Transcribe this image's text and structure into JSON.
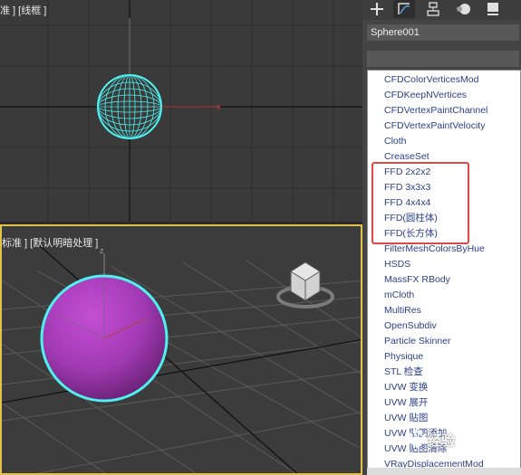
{
  "viewport_top": {
    "label": "准 ] [线框 ]"
  },
  "viewport_persp": {
    "label": "标准 ] [默认明暗处理 ]"
  },
  "command_panel": {
    "tabs": [
      "create-icon",
      "modify-icon",
      "hierarchy-icon",
      "motion-icon",
      "display-icon"
    ],
    "object_name": "Sphere001",
    "modifier_stack": ""
  },
  "modifier_list": {
    "items": [
      "CFDColorVerticesMod",
      "CFDKeepNVertices",
      "CFDVertexPaintChannel",
      "CFDVertexPaintVelocity",
      "Cloth",
      "CreaseSet",
      "FFD 2x2x2",
      "FFD 3x3x3",
      "FFD 4x4x4",
      "FFD(圆柱体)",
      "FFD(长方体)",
      "FilterMeshColorsByHue",
      "HSDS",
      "MassFX RBody",
      "mCloth",
      "MultiRes",
      "OpenSubdiv",
      "Particle Skinner",
      "Physique",
      "STL 检查",
      "UVW 变换",
      "UVW 展开",
      "UVW 贴图",
      "UVW 贴图添加",
      "UVW 贴图清除",
      "VRayDisplacementMod"
    ],
    "highlighted": [
      "FFD 2x2x2",
      "FFD 3x3x3",
      "FFD 4x4x4",
      "FFD(圆柱体)",
      "FFD(长方体)"
    ]
  },
  "colors": {
    "highlight_box": "#e04848",
    "active_viewport_border": "#e3c24a",
    "selection_cyan": "#4ff0f0",
    "sphere_purple": "#a23ab4",
    "list_text": "#2a3f8a"
  },
  "watermark": {
    "text": "经验"
  }
}
